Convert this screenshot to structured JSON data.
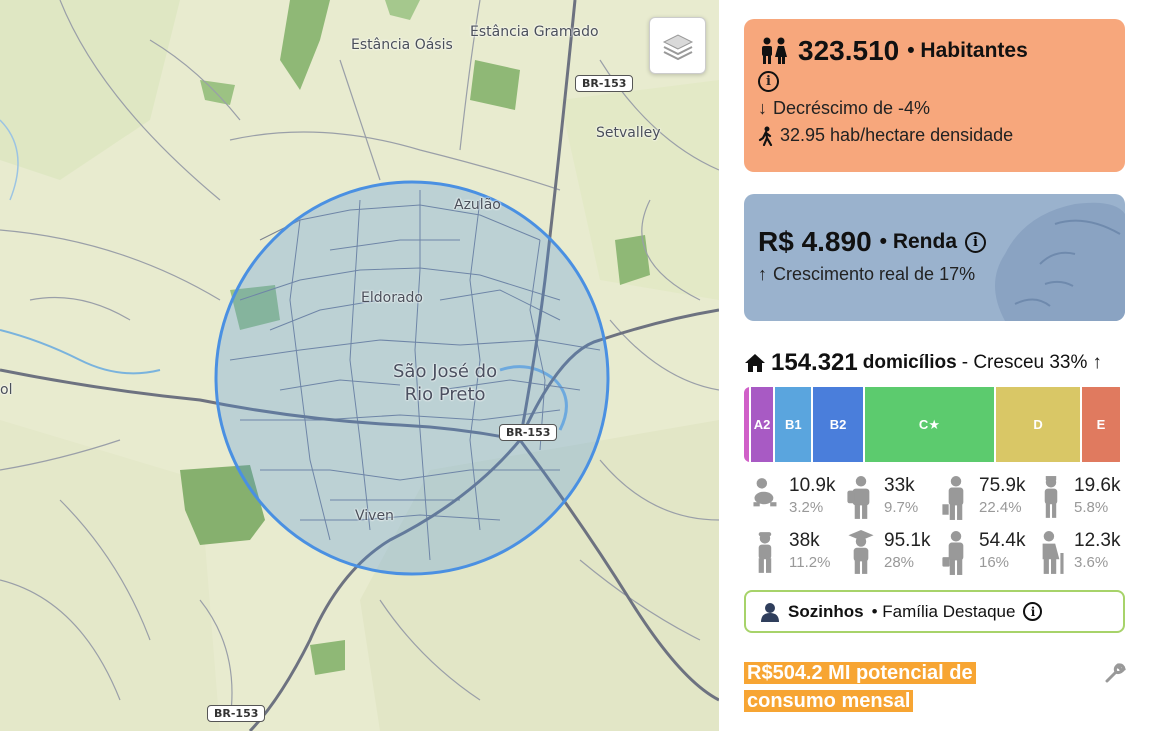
{
  "map": {
    "labels": {
      "estancia_oasis": "Estância Oásis",
      "estancia_gramado": "Estância Gramado",
      "setvalley": "Setvalley",
      "azulao": "Azulão",
      "eldorado": "Eldorado",
      "city_line1": "São José do",
      "city_line2": "Rio Preto",
      "viven": "Viven",
      "ol": "ol"
    },
    "shields": {
      "br153_top": "BR-153",
      "br153_mid": "BR-153",
      "br153_bottom": "BR-153"
    },
    "layers_icon": "layers-icon",
    "radius_color": "#4a90e2"
  },
  "population": {
    "value": "323.510",
    "label": "• Habitantes",
    "change": "Decréscimo de -4%",
    "density": "32.95 hab/hectare densidade",
    "bg_color": "#f7a77c"
  },
  "income": {
    "value": "R$ 4.890",
    "label": "• Renda",
    "growth": "Crescimento real de 17%",
    "bg_color": "#9ab2cd"
  },
  "households": {
    "value": "154.321",
    "label": "domicílios",
    "growth": "- Cresceu 33%"
  },
  "classes": [
    {
      "label": "",
      "share": 0.018,
      "color": "#d060c8"
    },
    {
      "label": "A2",
      "share": 0.064,
      "color": "#a85ac4"
    },
    {
      "label": "B1",
      "share": 0.1,
      "color": "#5aa5de"
    },
    {
      "label": "B2",
      "share": 0.135,
      "color": "#4a7edb"
    },
    {
      "label": "C",
      "share": 0.345,
      "color": "#5ccb6e",
      "star": true
    },
    {
      "label": "D",
      "share": 0.225,
      "color": "#d9c766"
    },
    {
      "label": "E",
      "share": 0.1,
      "color": "#e07a5f"
    }
  ],
  "age_groups": [
    {
      "value": "10.9k",
      "pct": "3.2%",
      "icon": "baby-icon"
    },
    {
      "value": "33k",
      "pct": "9.7%",
      "icon": "student-icon"
    },
    {
      "value": "75.9k",
      "pct": "22.4%",
      "icon": "adult-man-icon"
    },
    {
      "value": "19.6k",
      "pct": "5.8%",
      "icon": "older-man-icon"
    },
    {
      "value": "38k",
      "pct": "11.2%",
      "icon": "child-cap-icon"
    },
    {
      "value": "95.1k",
      "pct": "28%",
      "icon": "graduate-icon"
    },
    {
      "value": "54.4k",
      "pct": "16%",
      "icon": "businessman-icon"
    },
    {
      "value": "12.3k",
      "pct": "3.6%",
      "icon": "elderly-cane-icon"
    }
  ],
  "family": {
    "label": "Sozinhos",
    "suffix": "• Família Destaque"
  },
  "consumption": {
    "text": "R$504.2 MI potencial de consumo mensal"
  }
}
